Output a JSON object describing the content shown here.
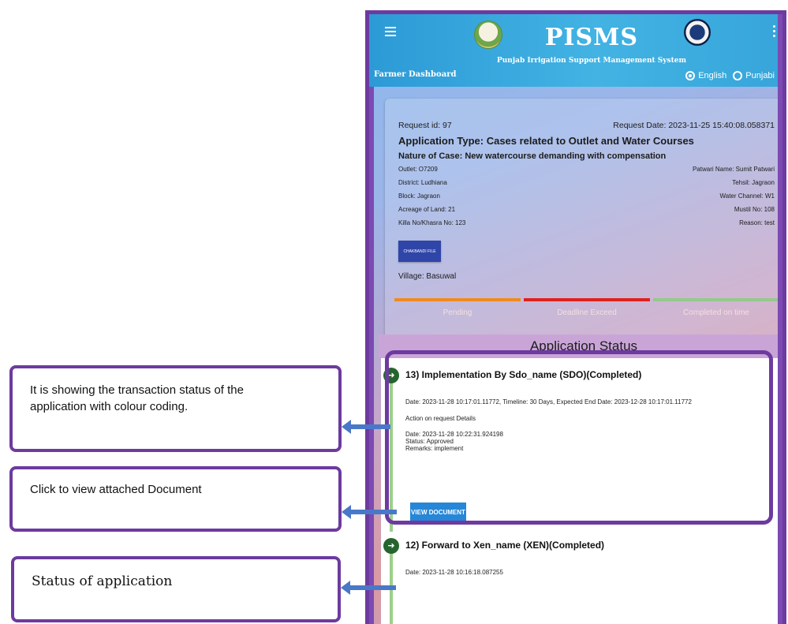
{
  "app": {
    "title": "PISMS",
    "subtitle": "Punjab Irrigation Support Management System",
    "dashboard_label": "Farmer Dashboard",
    "languages": [
      "English",
      "Punjabi"
    ],
    "selected_language": "English"
  },
  "request": {
    "id_text": "Request id: 97",
    "date_text": "Request Date: 2023-11-25 15:40:08.058371",
    "application_type": "Application Type: Cases related to Outlet and Water Courses",
    "nature_of_case": "Nature of Case: New watercourse demanding with compensation",
    "left_fields": [
      "Outlet: O7209",
      "District: Ludhiana",
      "Block: Jagraon",
      "Acreage of Land: 21",
      "Killa No/Khasra No: 123"
    ],
    "right_fields": [
      "Patwari Name: Sumit Patwari",
      "Tehsil: Jagraon",
      "Water Channel: W1",
      "Mustil No: 108",
      "Reason: test"
    ],
    "chakbandi_label": "CHAKBANDI FILE",
    "village": "Village: Basuwal"
  },
  "legend": [
    {
      "label": "Pending",
      "color": "#f08a1c"
    },
    {
      "label": "Deadline Exceed",
      "color": "#e0201d"
    },
    {
      "label": "Completed on time",
      "color": "#94c98c"
    }
  ],
  "status_heading": "Application Status",
  "steps": [
    {
      "title": "13) Implementation By Sdo_name (SDO)(Completed)",
      "date_line": "Date: 2023-11-28 10:17:01.11772, Timeline: 30 Days, Expected End Date: 2023-12-28 10:17:01.11772",
      "action_label": "Action on request Details",
      "action_date": "Date: 2023-11-28 10:22:31.924198",
      "action_status": "Status: Approved",
      "action_remarks": "Remarks: implement",
      "button_label": "VIEW DOCUMENT"
    },
    {
      "title": "12) Forward to Xen_name (XEN)(Completed)",
      "date_line": "Date: 2023-11-28 10:16:18.087255"
    }
  ],
  "annotations": [
    {
      "text_line1": "It is showing the transaction status of the",
      "text_line2": "application with colour coding."
    },
    {
      "text": "Click to view attached Document"
    },
    {
      "text": "Status of application"
    }
  ],
  "colors": {
    "frame": "#6d3aa0",
    "appbar": "#2c9ad6",
    "arrow": "#4a78c8",
    "step_icon": "#27642f",
    "timeline": "#9bd08b",
    "button": "#2687d8"
  },
  "icons": [
    "menu-icon",
    "more-vert-icon",
    "arrow-right-icon"
  ]
}
